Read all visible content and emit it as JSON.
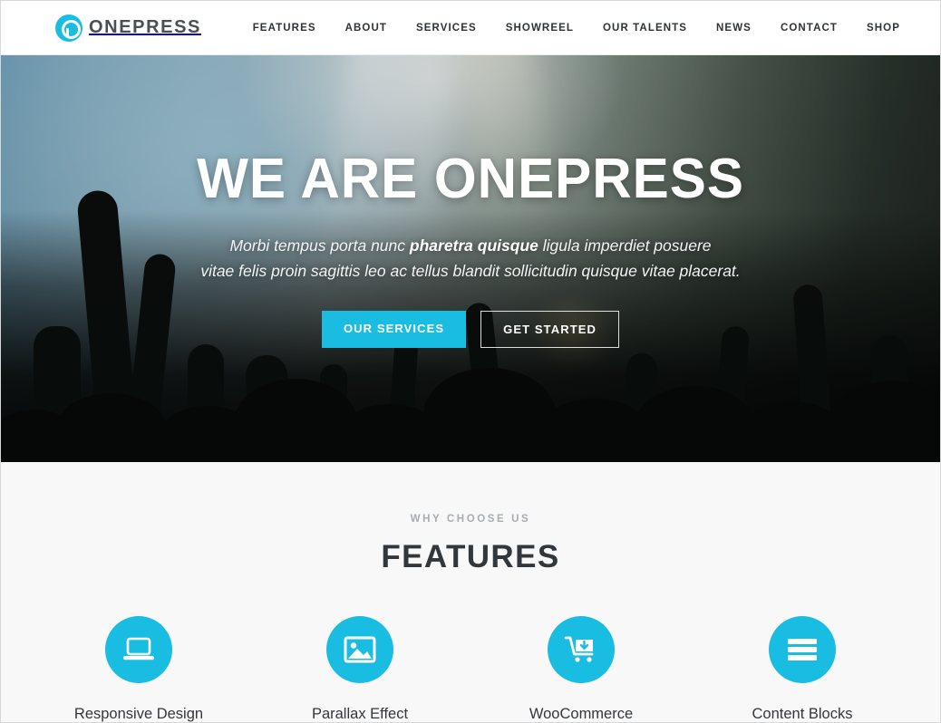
{
  "header": {
    "brand": {
      "name": "ONEPRESS",
      "mark_icon": "onepress-logo-icon"
    },
    "nav": [
      {
        "label": "FEATURES"
      },
      {
        "label": "ABOUT"
      },
      {
        "label": "SERVICES"
      },
      {
        "label": "SHOWREEL"
      },
      {
        "label": "OUR TALENTS"
      },
      {
        "label": "NEWS"
      },
      {
        "label": "CONTACT"
      },
      {
        "label": "SHOP"
      }
    ]
  },
  "hero": {
    "title": "WE ARE ONEPRESS",
    "subtitle_line1_before": "Morbi tempus porta nunc ",
    "subtitle_line1_bold": "pharetra quisque",
    "subtitle_line1_after": " ligula imperdiet posuere",
    "subtitle_line2": "vitae felis proin sagittis leo ac tellus blandit sollicitudin quisque vitae placerat.",
    "primary_button": "OUR SERVICES",
    "secondary_button": "GET STARTED",
    "background": "concert-crowd-photo"
  },
  "features": {
    "eyebrow": "WHY CHOOSE US",
    "title": "FEATURES",
    "items": [
      {
        "label": "Responsive Design",
        "icon": "laptop-icon"
      },
      {
        "label": "Parallax Effect",
        "icon": "image-icon"
      },
      {
        "label": "WooCommerce",
        "icon": "shopping-cart-icon"
      },
      {
        "label": "Content Blocks",
        "icon": "content-blocks-icon"
      }
    ]
  },
  "colors": {
    "accent": "#19bde2",
    "heading": "#32373c",
    "nav_text": "#2f3338",
    "eyebrow": "#a9adb1",
    "section_bg": "#f8f8f8",
    "header_bg": "#ffffff"
  }
}
